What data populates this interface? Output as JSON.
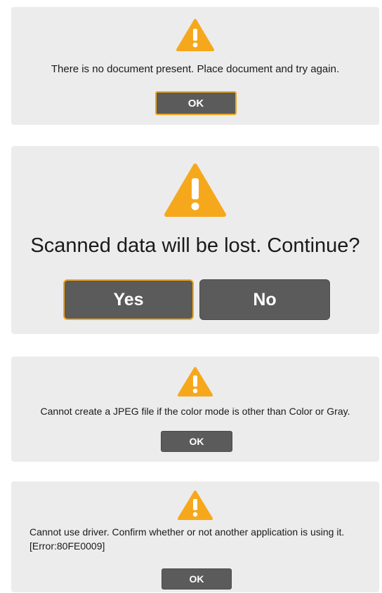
{
  "dialogs": [
    {
      "icon": "warning-icon",
      "message": "There is no document present. Place document and try again.",
      "buttons": [
        "OK"
      ]
    },
    {
      "icon": "warning-icon",
      "message": "Scanned data will be lost. Continue?",
      "buttons": [
        "Yes",
        "No"
      ]
    },
    {
      "icon": "warning-icon",
      "message": "Cannot create a JPEG file if the color mode is other than Color or Gray.",
      "buttons": [
        "OK"
      ]
    },
    {
      "icon": "warning-icon",
      "message_line1": "Cannot use driver. Confirm whether or not another application is using it.",
      "message_line2": "[Error:80FE0009]",
      "buttons": [
        "OK"
      ]
    }
  ],
  "colors": {
    "dialog_background": "#ececec",
    "button_background": "#5b5b5b",
    "button_text": "#ffffff",
    "focus_border": "#f3a51c",
    "warning_fill": "#f6a81c"
  }
}
